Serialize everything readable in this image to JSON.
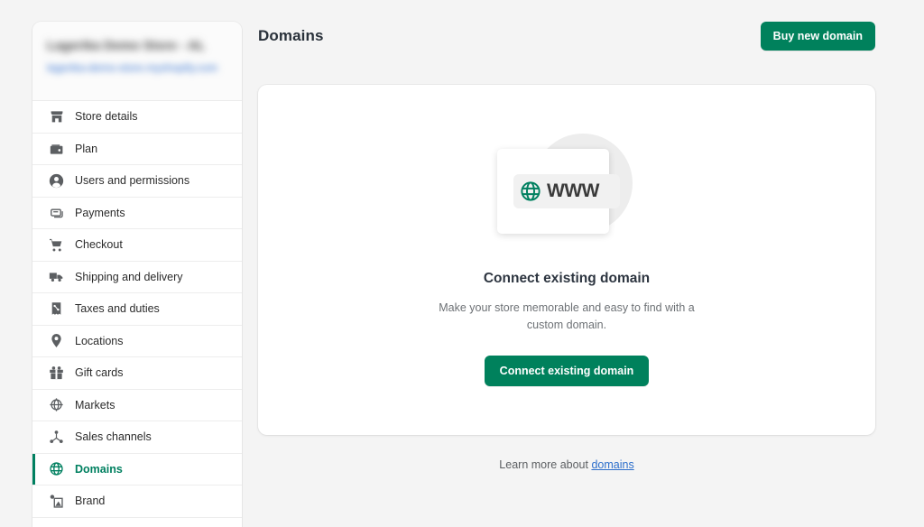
{
  "sidebar": {
    "store": {
      "name": "Lagerika Demo Store - AL",
      "url": "lagerika-demo-store.myshopify.com",
      "redacted": true
    },
    "items": [
      {
        "label": "Store details",
        "icon": "store-icon",
        "active": false
      },
      {
        "label": "Plan",
        "icon": "wallet-icon",
        "active": false
      },
      {
        "label": "Users and permissions",
        "icon": "user-circle-icon",
        "active": false
      },
      {
        "label": "Payments",
        "icon": "payment-card-icon",
        "active": false
      },
      {
        "label": "Checkout",
        "icon": "shopping-cart-icon",
        "active": false
      },
      {
        "label": "Shipping and delivery",
        "icon": "truck-icon",
        "active": false
      },
      {
        "label": "Taxes and duties",
        "icon": "receipt-percent-icon",
        "active": false
      },
      {
        "label": "Locations",
        "icon": "map-pin-icon",
        "active": false
      },
      {
        "label": "Gift cards",
        "icon": "gift-icon",
        "active": false
      },
      {
        "label": "Markets",
        "icon": "globe-target-icon",
        "active": false
      },
      {
        "label": "Sales channels",
        "icon": "channels-node-icon",
        "active": false
      },
      {
        "label": "Domains",
        "icon": "globe-icon",
        "active": true
      },
      {
        "label": "Brand",
        "icon": "brand-image-icon",
        "active": false
      }
    ]
  },
  "header": {
    "title": "Domains",
    "buy_button": "Buy new domain"
  },
  "main": {
    "illustration": {
      "www_text": "WWW",
      "globe_icon": "globe-icon"
    },
    "empty_state": {
      "title": "Connect existing domain",
      "description": "Make your store memorable and easy to find with a custom domain.",
      "cta_label": "Connect existing domain"
    },
    "footer": {
      "prefix": "Learn more about ",
      "link_text": "domains"
    }
  },
  "colors": {
    "accent_green": "#00815c",
    "active_green": "#008060",
    "link_blue": "#2c6ecb",
    "page_background": "#f4f4f4",
    "surface": "#ffffff"
  }
}
